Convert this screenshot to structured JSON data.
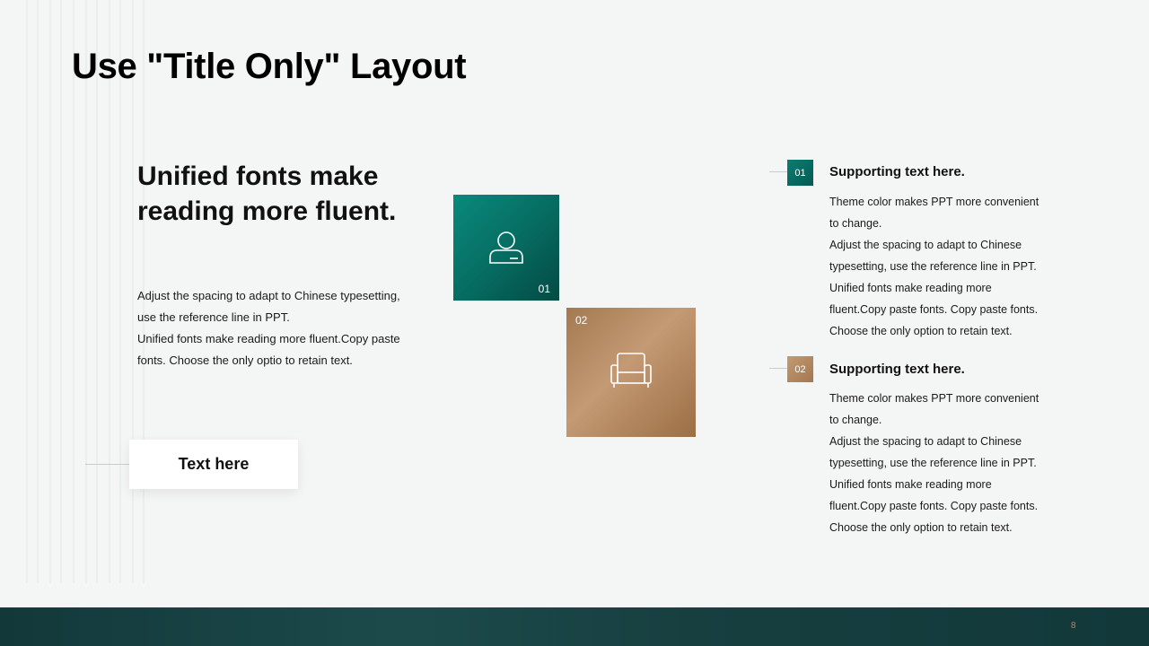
{
  "slide": {
    "title": "Use \"Title Only\" Layout",
    "page_number": "8"
  },
  "left": {
    "heading": "Unified fonts make reading more fluent.",
    "body_lines": [
      "Adjust the spacing to adapt to Chinese  typesetting,",
      "use the reference line  in PPT.",
      "Unified  fonts make reading more fluent.Copy paste",
      "fonts. Choose the only optio to retain text."
    ],
    "button_label": "Text here"
  },
  "tiles": [
    {
      "number": "01",
      "icon": "person-icon",
      "color": "#0a8a7c"
    },
    {
      "number": "02",
      "icon": "armchair-icon",
      "color": "#c39a74"
    }
  ],
  "items": [
    {
      "number": "01",
      "title": "Supporting text here.",
      "lines": [
        "Theme  color makes PPT more convenient",
        "to change.",
        "Adjust the spacing to adapt to Chinese",
        "typesetting, use the reference line  in PPT.",
        "Unified  fonts make reading more",
        "fluent.Copy paste fonts. Copy paste  fonts.",
        "Choose the only option to retain text."
      ]
    },
    {
      "number": "02",
      "title": "Supporting text here.",
      "lines": [
        "Theme  color makes PPT more convenient",
        "to change.",
        "Adjust the spacing to adapt to Chinese",
        "typesetting, use the reference line  in PPT.",
        "Unified  fonts make reading more",
        "fluent.Copy paste fonts. Copy paste  fonts.",
        "Choose the only option to retain text."
      ]
    }
  ],
  "colors": {
    "accent_teal": "#066a60",
    "accent_bronze": "#b08a64",
    "footer": "#173f40"
  }
}
